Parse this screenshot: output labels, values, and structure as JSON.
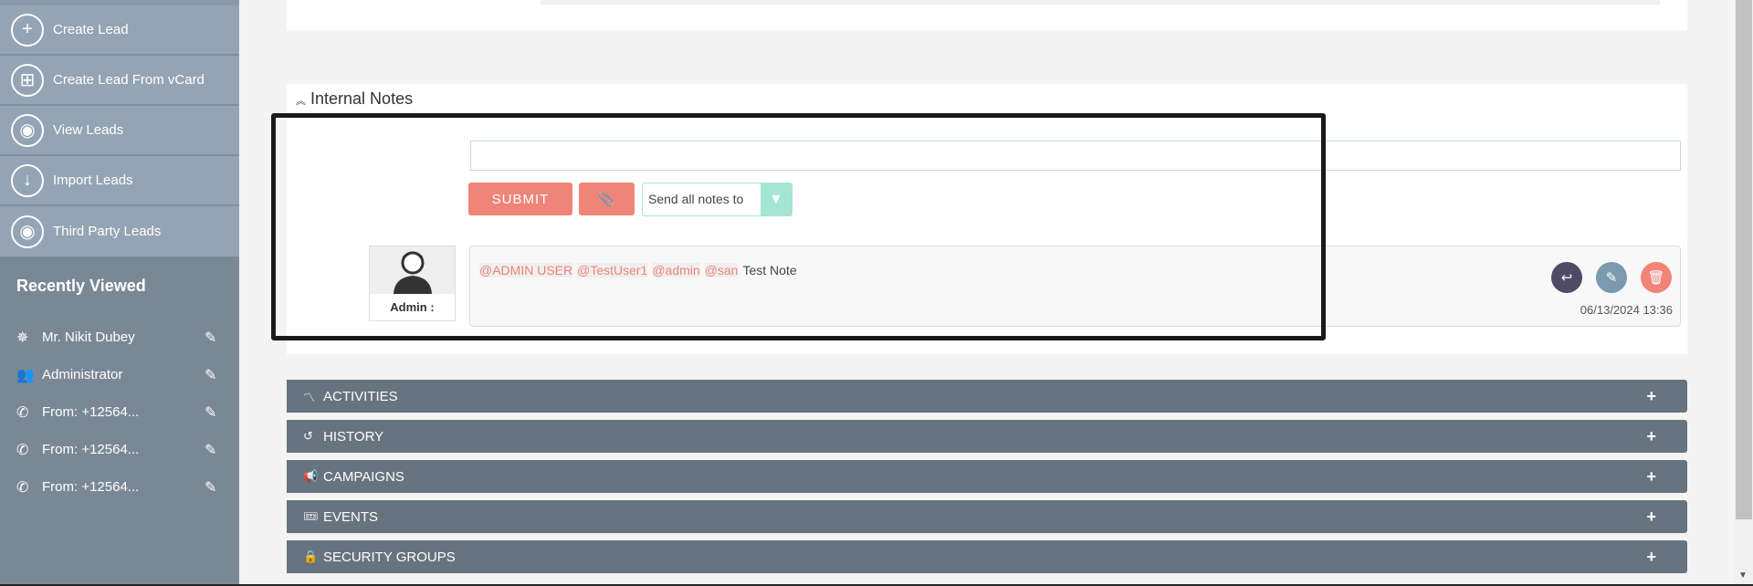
{
  "sidebar": {
    "actions": [
      {
        "label": "Create Lead",
        "icon": "plus-circle-icon"
      },
      {
        "label": "Create Lead From vCard",
        "icon": "vcard-icon"
      },
      {
        "label": "View Leads",
        "icon": "eye-icon"
      },
      {
        "label": "Import Leads",
        "icon": "download-icon"
      },
      {
        "label": "Third Party Leads",
        "icon": "eye-icon"
      }
    ],
    "recently_viewed_title": "Recently Viewed",
    "recent": [
      {
        "label": "Mr. Nikit Dubey",
        "icon": "lead-icon"
      },
      {
        "label": "Administrator",
        "icon": "users-icon"
      },
      {
        "label": "From: +12564...",
        "icon": "phone-icon"
      },
      {
        "label": "From: +12564...",
        "icon": "phone-icon"
      },
      {
        "label": "From: +12564...",
        "icon": "phone-icon"
      }
    ]
  },
  "notes": {
    "title": "Internal Notes",
    "input_value": "",
    "submit_label": "SUBMIT",
    "select_value": "Send all notes to",
    "note": {
      "author": "Admin :",
      "mentions": [
        "@ADMIN USER",
        "@TestUser1",
        "@admin",
        "@san"
      ],
      "text": "Test Note",
      "date": "06/13/2024 13:36"
    }
  },
  "sections": [
    {
      "label": "ACTIVITIES",
      "icon": "activity-icon"
    },
    {
      "label": "HISTORY",
      "icon": "history-icon"
    },
    {
      "label": "CAMPAIGNS",
      "icon": "megaphone-icon"
    },
    {
      "label": "EVENTS",
      "icon": "ticket-icon"
    },
    {
      "label": "SECURITY GROUPS",
      "icon": "lock-icon"
    }
  ],
  "colors": {
    "accent": "#f08478",
    "section_bar": "#67737e",
    "sidebar": "#94a4b4",
    "reply": "#4f4a66",
    "edit": "#7a9ab0"
  }
}
